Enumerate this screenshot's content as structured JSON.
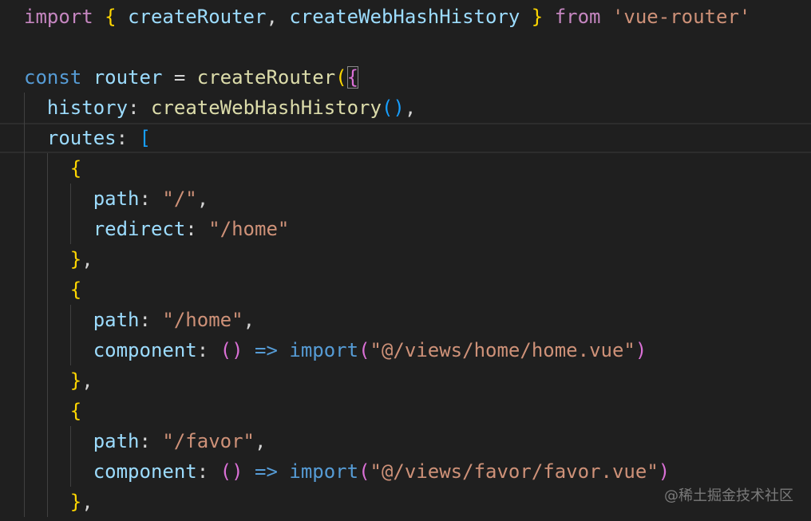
{
  "editor": {
    "theme": {
      "background": "#1f1f1f",
      "keyword": "#c586c0",
      "storage": "#569cd6",
      "variable": "#9cdcfe",
      "function": "#dcdcaa",
      "string": "#ce9178",
      "punctuation": "#d4d4d4",
      "bracket_level_1": "#ffd700",
      "bracket_level_2": "#da70d6",
      "bracket_level_3": "#179fff"
    },
    "lines": [
      {
        "tokens": [
          {
            "t": "import",
            "k": "keyword"
          },
          {
            "t": " ",
            "k": "plain"
          },
          {
            "t": "{",
            "k": "brace-y"
          },
          {
            "t": " ",
            "k": "plain"
          },
          {
            "t": "createRouter",
            "k": "variable"
          },
          {
            "t": ", ",
            "k": "plain"
          },
          {
            "t": "createWebHashHistory",
            "k": "variable"
          },
          {
            "t": " ",
            "k": "plain"
          },
          {
            "t": "}",
            "k": "brace-y"
          },
          {
            "t": " ",
            "k": "plain"
          },
          {
            "t": "from",
            "k": "keyword"
          },
          {
            "t": " ",
            "k": "plain"
          },
          {
            "t": "'vue-router'",
            "k": "string"
          }
        ]
      },
      {
        "tokens": []
      },
      {
        "tokens": [
          {
            "t": "const",
            "k": "storage"
          },
          {
            "t": " ",
            "k": "plain"
          },
          {
            "t": "router",
            "k": "variable"
          },
          {
            "t": " = ",
            "k": "plain"
          },
          {
            "t": "createRouter",
            "k": "func"
          },
          {
            "t": "(",
            "k": "brace-y"
          },
          {
            "t": "{",
            "k": "brace-p",
            "m": true
          }
        ]
      },
      {
        "tokens": [
          {
            "t": "  ",
            "k": "plain"
          },
          {
            "t": "history",
            "k": "variable"
          },
          {
            "t": ": ",
            "k": "plain"
          },
          {
            "t": "createWebHashHistory",
            "k": "func"
          },
          {
            "t": "()",
            "k": "brace-b"
          },
          {
            "t": ",",
            "k": "plain"
          }
        ]
      },
      {
        "current": true,
        "tokens": [
          {
            "t": "  ",
            "k": "plain"
          },
          {
            "t": "routes",
            "k": "variable"
          },
          {
            "t": ": ",
            "k": "plain"
          },
          {
            "t": "[",
            "k": "brace-b"
          }
        ]
      },
      {
        "tokens": [
          {
            "t": "    ",
            "k": "plain"
          },
          {
            "t": "{",
            "k": "brace-y"
          }
        ]
      },
      {
        "tokens": [
          {
            "t": "      ",
            "k": "plain"
          },
          {
            "t": "path",
            "k": "variable"
          },
          {
            "t": ": ",
            "k": "plain"
          },
          {
            "t": "\"/\"",
            "k": "string"
          },
          {
            "t": ",",
            "k": "plain"
          }
        ]
      },
      {
        "tokens": [
          {
            "t": "      ",
            "k": "plain"
          },
          {
            "t": "redirect",
            "k": "variable"
          },
          {
            "t": ": ",
            "k": "plain"
          },
          {
            "t": "\"/home\"",
            "k": "string"
          }
        ]
      },
      {
        "tokens": [
          {
            "t": "    ",
            "k": "plain"
          },
          {
            "t": "}",
            "k": "brace-y"
          },
          {
            "t": ",",
            "k": "plain"
          }
        ]
      },
      {
        "tokens": [
          {
            "t": "    ",
            "k": "plain"
          },
          {
            "t": "{",
            "k": "brace-y"
          }
        ]
      },
      {
        "tokens": [
          {
            "t": "      ",
            "k": "plain"
          },
          {
            "t": "path",
            "k": "variable"
          },
          {
            "t": ": ",
            "k": "plain"
          },
          {
            "t": "\"/home\"",
            "k": "string"
          },
          {
            "t": ",",
            "k": "plain"
          }
        ]
      },
      {
        "tokens": [
          {
            "t": "      ",
            "k": "plain"
          },
          {
            "t": "component",
            "k": "variable"
          },
          {
            "t": ": ",
            "k": "plain"
          },
          {
            "t": "()",
            "k": "brace-p"
          },
          {
            "t": " ",
            "k": "plain"
          },
          {
            "t": "=>",
            "k": "storage"
          },
          {
            "t": " ",
            "k": "plain"
          },
          {
            "t": "import",
            "k": "storage"
          },
          {
            "t": "(",
            "k": "brace-p"
          },
          {
            "t": "\"@/views/home/home.vue\"",
            "k": "string"
          },
          {
            "t": ")",
            "k": "brace-p"
          }
        ]
      },
      {
        "tokens": [
          {
            "t": "    ",
            "k": "plain"
          },
          {
            "t": "}",
            "k": "brace-y"
          },
          {
            "t": ",",
            "k": "plain"
          }
        ]
      },
      {
        "tokens": [
          {
            "t": "    ",
            "k": "plain"
          },
          {
            "t": "{",
            "k": "brace-y"
          }
        ]
      },
      {
        "tokens": [
          {
            "t": "      ",
            "k": "plain"
          },
          {
            "t": "path",
            "k": "variable"
          },
          {
            "t": ": ",
            "k": "plain"
          },
          {
            "t": "\"/favor\"",
            "k": "string"
          },
          {
            "t": ",",
            "k": "plain"
          }
        ]
      },
      {
        "tokens": [
          {
            "t": "      ",
            "k": "plain"
          },
          {
            "t": "component",
            "k": "variable"
          },
          {
            "t": ": ",
            "k": "plain"
          },
          {
            "t": "()",
            "k": "brace-p"
          },
          {
            "t": " ",
            "k": "plain"
          },
          {
            "t": "=>",
            "k": "storage"
          },
          {
            "t": " ",
            "k": "plain"
          },
          {
            "t": "import",
            "k": "storage"
          },
          {
            "t": "(",
            "k": "brace-p"
          },
          {
            "t": "\"@/views/favor/favor.vue\"",
            "k": "string"
          },
          {
            "t": ")",
            "k": "brace-p"
          }
        ]
      },
      {
        "tokens": [
          {
            "t": "    ",
            "k": "plain"
          },
          {
            "t": "}",
            "k": "brace-y"
          },
          {
            "t": ",",
            "k": "plain"
          }
        ]
      }
    ]
  },
  "watermark": "@稀土掘金技术社区"
}
